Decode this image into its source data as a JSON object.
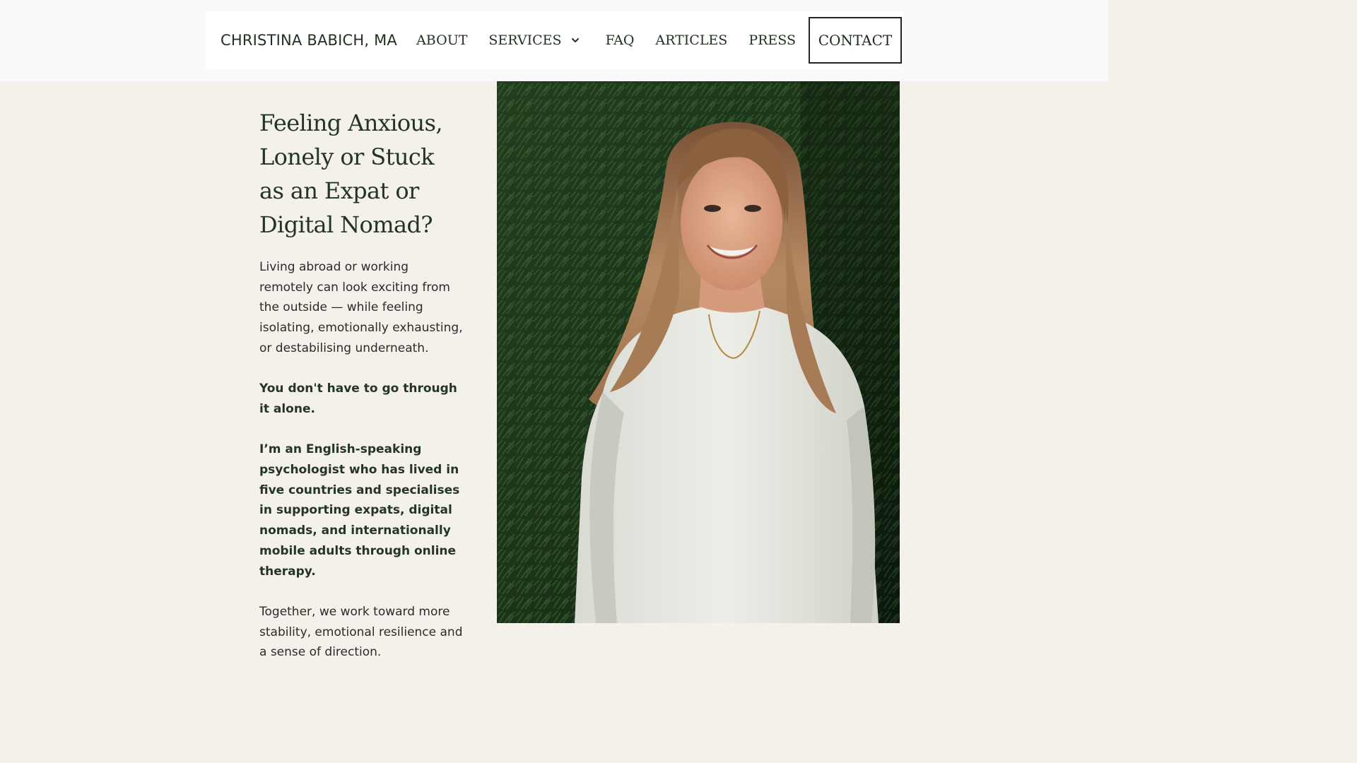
{
  "header": {
    "logo": "CHRISTINA BABICH, MA",
    "nav": {
      "about": "ABOUT",
      "services": "SERVICES",
      "faq": "FAQ",
      "articles": "ARTICLES",
      "press": "PRESS",
      "contact": "CONTACT"
    },
    "services_icon": "chevron-down-icon"
  },
  "hero": {
    "headline": [
      "Feeling Anxious,",
      "Lonely or Stuck",
      "as an Expat or",
      "Digital Nomad?"
    ],
    "intro": "Living abroad or working remotely can look exciting from the outside — while feeling isolating, emotionally exhausting, or destabilising underneath.",
    "emphasis": "You don't have to go through it alone.",
    "bio": "I’m an English-speaking psychologist who has lived in five countries and specialises in supporting expats, digital nomads, and internationally mobile adults through online therapy.",
    "closing": "Together, we work toward more stability, emotional resilience and a sense of direction."
  },
  "colors": {
    "page_bg": "#f4f0ea",
    "header_bg": "#fafafa",
    "text_dark": "#243024",
    "foliage": "#1f3a1d"
  }
}
